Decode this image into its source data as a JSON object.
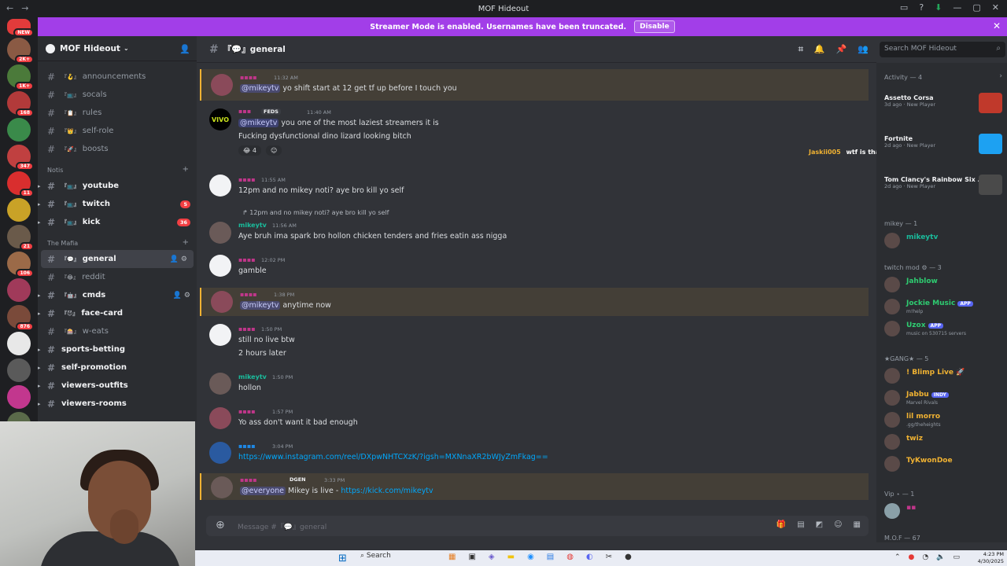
{
  "window": {
    "title": "MOF Hideout"
  },
  "banner": {
    "text": "Streamer Mode is enabled. Usernames have been truncated.",
    "button": "Disable"
  },
  "guilds": [
    {
      "badge": "NEW",
      "color": "#e23b3b"
    },
    {
      "badge": "2K+",
      "color": "#8a5a44"
    },
    {
      "badge": "1K+",
      "color": "#4b7a3a"
    },
    {
      "badge": "168",
      "color": "#b23a3a"
    },
    {
      "badge": "",
      "color": "#3a8a4a"
    },
    {
      "badge": "347",
      "color": "#c04040"
    },
    {
      "badge": "11",
      "color": "#d92e2e"
    },
    {
      "badge": "",
      "color": "#c9a227"
    },
    {
      "badge": "21",
      "color": "#6a5a4a"
    },
    {
      "badge": "106",
      "color": "#9b6a48"
    },
    {
      "badge": "",
      "color": "#a03a5a"
    },
    {
      "badge": "876",
      "color": "#7a4a3a"
    },
    {
      "badge": "",
      "color": "#e8e8e8"
    },
    {
      "badge": "",
      "color": "#5a5a5a"
    },
    {
      "badge": "",
      "color": "#c2378e"
    },
    {
      "badge": "497",
      "color": "#5a6a4a"
    },
    {
      "badge": "",
      "color": "#8a8a5a"
    }
  ],
  "server": {
    "name": "MOF Hideout"
  },
  "channels_top": [
    {
      "emoji": "『🪝』",
      "name": "announcements"
    },
    {
      "emoji": "『📺』",
      "name": "socals"
    },
    {
      "emoji": "『📋』",
      "name": "rules"
    },
    {
      "emoji": "『👑』",
      "name": "self-role"
    },
    {
      "emoji": "『🚀』",
      "name": "boosts"
    }
  ],
  "cat_notis": "Notis",
  "channels_notis": [
    {
      "emoji": "『📺』",
      "name": "youtube",
      "ping": ""
    },
    {
      "emoji": "『📺』",
      "name": "twitch",
      "ping": "5"
    },
    {
      "emoji": "『📺』",
      "name": "kick",
      "ping": "36"
    }
  ],
  "cat_mafia": "The Mafia",
  "channels_mafia": [
    {
      "emoji": "『💬』",
      "name": "general"
    },
    {
      "emoji": "『😂』",
      "name": "reddit"
    },
    {
      "emoji": "『🤖』",
      "name": "cmds"
    },
    {
      "emoji": "『😈』",
      "name": "face-card"
    },
    {
      "emoji": "『🎰』",
      "name": "w-eats"
    }
  ],
  "channels_bottom": [
    "sports-betting",
    "self-promotion",
    "viewers-outfits",
    "viewers-rooms"
  ],
  "channel_header": {
    "name": "『💬』general",
    "search_placeholder": "Search MOF Hideout"
  },
  "messages": {
    "m1": {
      "ts": "11:32 AM",
      "mention": "@mikeytv",
      "text": " yo shift start at 12 get tf up before I touch you"
    },
    "m2": {
      "tag": "FEDS",
      "ts": "11:40 AM",
      "mention": "@mikeytv",
      "text": " you one of the most laziest streamers it is",
      "text2": "Fucking dysfunctional dino lizard looking bitch",
      "react": "😂 4"
    },
    "m3": {
      "ts": "11:55 AM",
      "text": "12pm and no mikey noti? aye bro kill yo self"
    },
    "m4": {
      "reply": "12pm and no mikey noti? aye bro kill yo self",
      "user": "mikeytv",
      "ts": "11:56 AM",
      "text": "Aye bruh ima spark bro hollon chicken tenders and fries eatin ass nigga"
    },
    "m5": {
      "ts": "12:02 PM",
      "text": "gamble"
    },
    "m6": {
      "ts": "1:38 PM",
      "mention": "@mikeytv",
      "text": " anytime now"
    },
    "m7": {
      "ts": "1:50 PM",
      "text": "still no live btw",
      "text2": "2 hours later"
    },
    "m8": {
      "user": "mikeytv",
      "ts": "1:50 PM",
      "text": "hollon"
    },
    "m9": {
      "ts": "1:57 PM",
      "text": "Yo ass don't want it bad enough"
    },
    "m10": {
      "ts": "3:04 PM",
      "link": "https://www.instagram.com/reel/DXpwNHTCXzK/?igsh=MXNnaXR2bWJyZmFkag=="
    },
    "m11": {
      "tag": "DGEN",
      "ts": "3:33 PM",
      "mention": "@everyone",
      "text": " Mikey is live - ",
      "link": "https://kick.com/mikeytv"
    }
  },
  "floater": {
    "who": "Jaskii005",
    "what": "wtf is that thing"
  },
  "composer": {
    "placeholder": "Message #『💬』general"
  },
  "members": {
    "activity_head": "Activity — 4",
    "activities": [
      {
        "game": "Assetto Corsa",
        "meta": "3d ago · New Player",
        "color": "#c0392b"
      },
      {
        "game": "Fortnite",
        "meta": "2d ago · New Player",
        "color": "#1da1f2"
      },
      {
        "game": "Tom Clancy's Rainbow Six ...",
        "meta": "2d ago · New Player",
        "color": "#4a4a4a"
      }
    ],
    "g_mikey": "mikey — 1",
    "mikey": [
      {
        "name": "mikeytv",
        "color": "#1abc9c",
        "sub": ""
      }
    ],
    "g_mod": "twitch mod ⚙ — 3",
    "mods": [
      {
        "name": "Jahblow",
        "color": "#2ecc71",
        "sub": "",
        "tag": ""
      },
      {
        "name": "Jockie Music",
        "color": "#2ecc71",
        "sub": "m!help",
        "tag": "APP"
      },
      {
        "name": "Uzox",
        "color": "#2ecc71",
        "sub": "music on 530715 servers",
        "tag": "APP"
      }
    ],
    "g_gang": "★GANG★ — 5",
    "gang": [
      {
        "name": "! Blimp Live 🚀",
        "color": "#f0b232",
        "sub": ""
      },
      {
        "name": "Jabbu",
        "color": "#f0b232",
        "sub": "Marvel Rivals",
        "tag": "INDY"
      },
      {
        "name": "lil morro",
        "color": "#f0b232",
        "sub": ".gg/theheights"
      },
      {
        "name": "twiz",
        "color": "#f0b232",
        "sub": ""
      },
      {
        "name": "TyKwonDoe",
        "color": "#f0b232",
        "sub": ""
      }
    ],
    "g_vip": "Vip ⋆ — 1",
    "g_mof": "M.O.F — 67"
  },
  "taskbar": {
    "search": "Search",
    "time": "4:23 PM",
    "date": "4/30/2025"
  }
}
